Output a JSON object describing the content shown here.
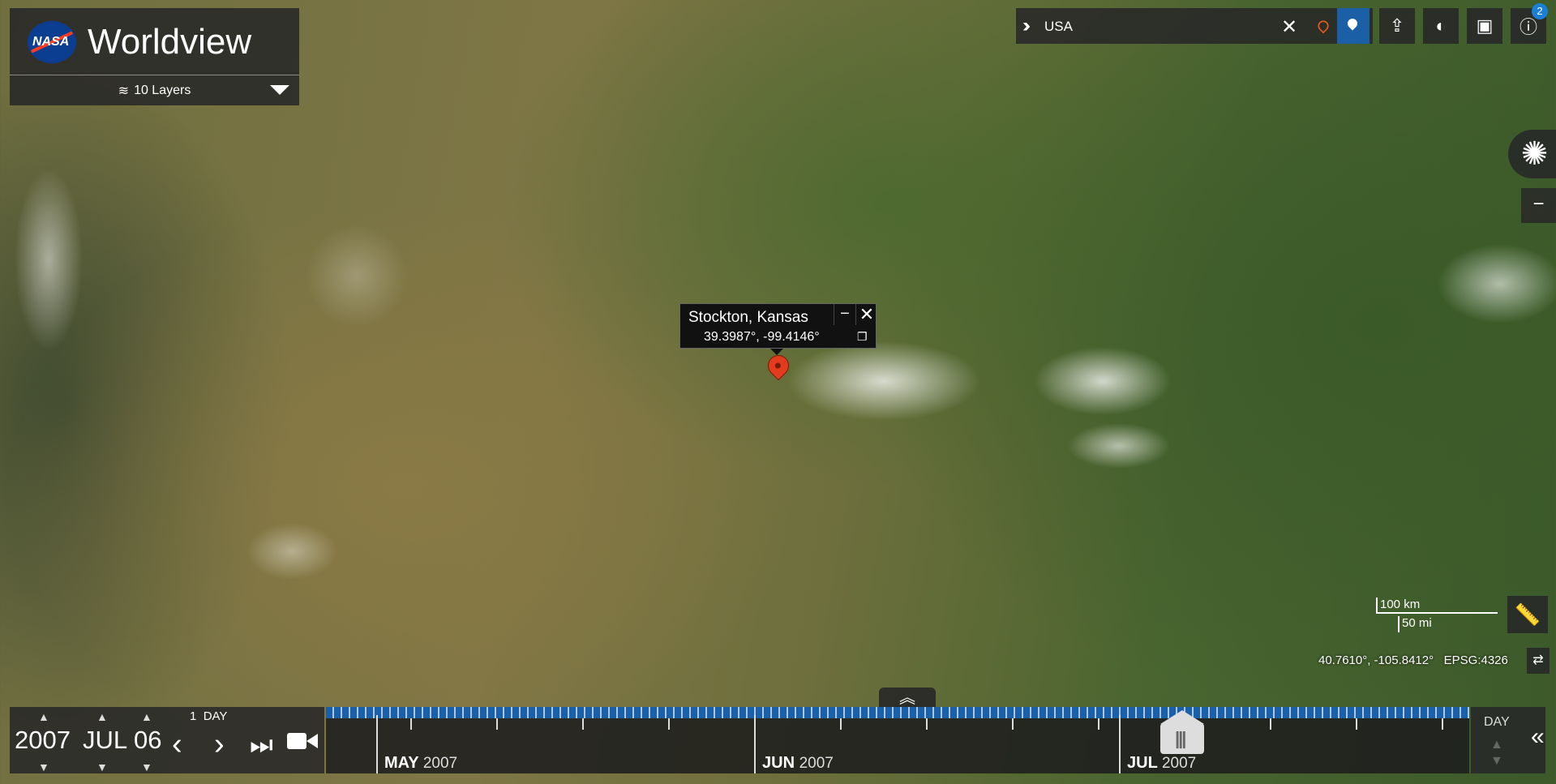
{
  "app": {
    "title": "Worldview",
    "logo": "NASA"
  },
  "layers": {
    "label": "10 Layers"
  },
  "search": {
    "value": "USA",
    "clear_icon": "✕"
  },
  "toolbar": {
    "info_badge": "2"
  },
  "marker": {
    "name": "Stockton, Kansas",
    "coords": "39.3987°, -99.4146°"
  },
  "scale": {
    "km": "100 km",
    "mi": "50 mi"
  },
  "cursor": {
    "coords": "40.7610°, -105.8412°",
    "projection": "EPSG:4326"
  },
  "date": {
    "year": "2007",
    "month": "JUL",
    "day": "06",
    "interval_count": "1",
    "interval_unit": "DAY"
  },
  "timeline": {
    "months": [
      {
        "month": "MAY",
        "year": "2007"
      },
      {
        "month": "JUN",
        "year": "2007"
      },
      {
        "month": "JUL",
        "year": "2007"
      }
    ],
    "zoom": "DAY"
  },
  "colors": {
    "accent": "#1b5fa6",
    "marker": "#e23b1d",
    "search_pin": "#e85a1f"
  },
  "icons": {
    "layers": "layers-icon",
    "caret": "caret-down-icon",
    "expand": "double-chevron-right-icon",
    "share": "share-icon",
    "projection": "globe-icon",
    "snapshot": "camera-icon",
    "info": "info-icon",
    "ruler": "ruler-icon",
    "copy": "copy-icon",
    "video": "video-camera-icon"
  }
}
